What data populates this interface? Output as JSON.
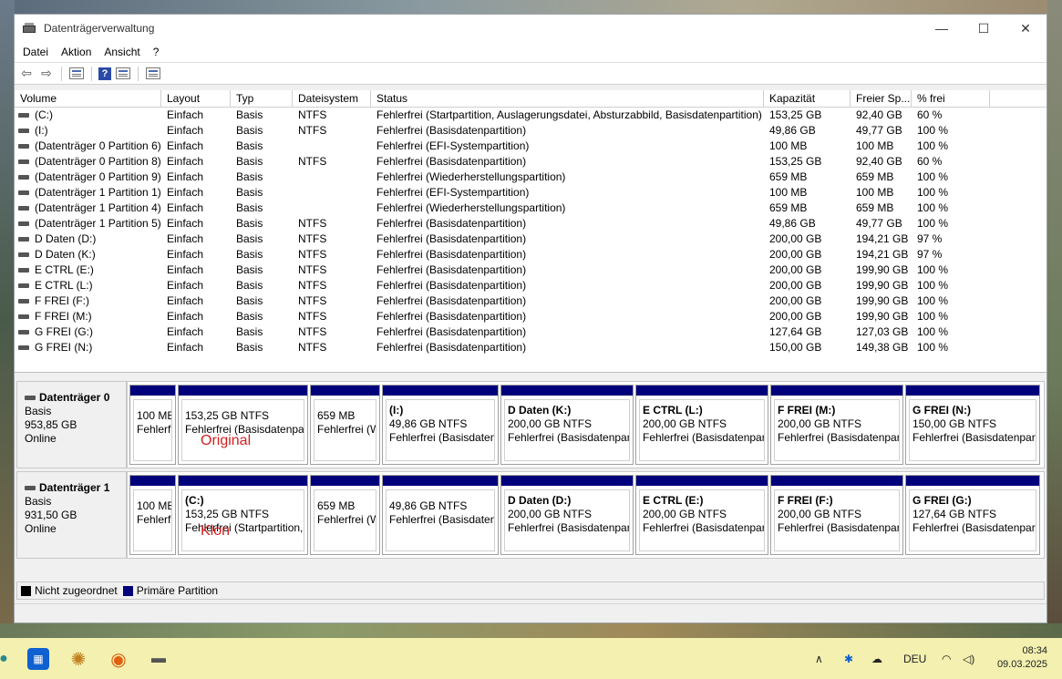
{
  "window": {
    "title": "Datenträgerverwaltung",
    "controls": [
      "—",
      "☐",
      "✕"
    ]
  },
  "menu": [
    "Datei",
    "Aktion",
    "Ansicht",
    "?"
  ],
  "volumes": {
    "headers": [
      "Volume",
      "Layout",
      "Typ",
      "Dateisystem",
      "Status",
      "Kapazität",
      "Freier Sp...",
      "% frei"
    ],
    "rows": [
      [
        "(C:)",
        "Einfach",
        "Basis",
        "NTFS",
        "Fehlerfrei (Startpartition, Auslagerungsdatei, Absturzabbild, Basisdatenpartition)",
        "153,25 GB",
        "92,40 GB",
        "60 %"
      ],
      [
        "(I:)",
        "Einfach",
        "Basis",
        "NTFS",
        "Fehlerfrei (Basisdatenpartition)",
        "49,86 GB",
        "49,77 GB",
        "100 %"
      ],
      [
        "(Datenträger 0 Partition 6)",
        "Einfach",
        "Basis",
        "",
        "Fehlerfrei (EFI-Systempartition)",
        "100 MB",
        "100 MB",
        "100 %"
      ],
      [
        "(Datenträger 0 Partition 8)",
        "Einfach",
        "Basis",
        "NTFS",
        "Fehlerfrei (Basisdatenpartition)",
        "153,25 GB",
        "92,40 GB",
        "60 %"
      ],
      [
        "(Datenträger 0 Partition 9)",
        "Einfach",
        "Basis",
        "",
        "Fehlerfrei (Wiederherstellungspartition)",
        "659 MB",
        "659 MB",
        "100 %"
      ],
      [
        "(Datenträger 1 Partition 1)",
        "Einfach",
        "Basis",
        "",
        "Fehlerfrei (EFI-Systempartition)",
        "100 MB",
        "100 MB",
        "100 %"
      ],
      [
        "(Datenträger 1 Partition 4)",
        "Einfach",
        "Basis",
        "",
        "Fehlerfrei (Wiederherstellungspartition)",
        "659 MB",
        "659 MB",
        "100 %"
      ],
      [
        "(Datenträger 1 Partition 5)",
        "Einfach",
        "Basis",
        "NTFS",
        "Fehlerfrei (Basisdatenpartition)",
        "49,86 GB",
        "49,77 GB",
        "100 %"
      ],
      [
        "D Daten  (D:)",
        "Einfach",
        "Basis",
        "NTFS",
        "Fehlerfrei (Basisdatenpartition)",
        "200,00 GB",
        "194,21 GB",
        "97 %"
      ],
      [
        "D Daten  (K:)",
        "Einfach",
        "Basis",
        "NTFS",
        "Fehlerfrei (Basisdatenpartition)",
        "200,00 GB",
        "194,21 GB",
        "97 %"
      ],
      [
        "E CTRL (E:)",
        "Einfach",
        "Basis",
        "NTFS",
        "Fehlerfrei (Basisdatenpartition)",
        "200,00 GB",
        "199,90 GB",
        "100 %"
      ],
      [
        "E CTRL (L:)",
        "Einfach",
        "Basis",
        "NTFS",
        "Fehlerfrei (Basisdatenpartition)",
        "200,00 GB",
        "199,90 GB",
        "100 %"
      ],
      [
        "F FREI (F:)",
        "Einfach",
        "Basis",
        "NTFS",
        "Fehlerfrei (Basisdatenpartition)",
        "200,00 GB",
        "199,90 GB",
        "100 %"
      ],
      [
        "F FREI (M:)",
        "Einfach",
        "Basis",
        "NTFS",
        "Fehlerfrei (Basisdatenpartition)",
        "200,00 GB",
        "199,90 GB",
        "100 %"
      ],
      [
        "G FREI (G:)",
        "Einfach",
        "Basis",
        "NTFS",
        "Fehlerfrei (Basisdatenpartition)",
        "127,64 GB",
        "127,03 GB",
        "100 %"
      ],
      [
        "G FREI (N:)",
        "Einfach",
        "Basis",
        "NTFS",
        "Fehlerfrei (Basisdatenpartition)",
        "150,00 GB",
        "149,38 GB",
        "100 %"
      ]
    ]
  },
  "disks": [
    {
      "name": "Datenträger 0",
      "type": "Basis",
      "size": "953,85 GB",
      "state": "Online",
      "note": "Original",
      "partitions": [
        {
          "name": "",
          "size": "100 MB",
          "status": "Fehlerfr"
        },
        {
          "name": "",
          "size": "153,25 GB NTFS",
          "status": "Fehlerfrei (Basisdatenpar"
        },
        {
          "name": "",
          "size": "659 MB",
          "status": "Fehlerfrei (W"
        },
        {
          "name": "(I:)",
          "size": "49,86 GB NTFS",
          "status": "Fehlerfrei (Basisdaten"
        },
        {
          "name": "D Daten  (K:)",
          "size": "200,00 GB NTFS",
          "status": "Fehlerfrei (Basisdatenpart"
        },
        {
          "name": "E CTRL  (L:)",
          "size": "200,00 GB NTFS",
          "status": "Fehlerfrei (Basisdatenpart"
        },
        {
          "name": "F FREI  (M:)",
          "size": "200,00 GB NTFS",
          "status": "Fehlerfrei (Basisdatenpart"
        },
        {
          "name": "G FREI  (N:)",
          "size": "150,00 GB NTFS",
          "status": "Fehlerfrei (Basisdatenpart"
        }
      ]
    },
    {
      "name": "Datenträger 1",
      "type": "Basis",
      "size": "931,50 GB",
      "state": "Online",
      "note": "Klon",
      "partitions": [
        {
          "name": "",
          "size": "100 MB",
          "status": "Fehlerfr"
        },
        {
          "name": "(C:)",
          "size": "153,25 GB NTFS",
          "status": "Fehlerfrei (Startpartition,"
        },
        {
          "name": "",
          "size": "659 MB",
          "status": "Fehlerfrei (W"
        },
        {
          "name": "",
          "size": "49,86 GB NTFS",
          "status": "Fehlerfrei (Basisdaten"
        },
        {
          "name": "D Daten  (D:)",
          "size": "200,00 GB NTFS",
          "status": "Fehlerfrei (Basisdatenpart"
        },
        {
          "name": "E CTRL  (E:)",
          "size": "200,00 GB NTFS",
          "status": "Fehlerfrei (Basisdatenpart"
        },
        {
          "name": "F FREI  (F:)",
          "size": "200,00 GB NTFS",
          "status": "Fehlerfrei (Basisdatenpart"
        },
        {
          "name": "G FREI  (G:)",
          "size": "127,64 GB NTFS",
          "status": "Fehlerfrei (Basisdatenpart"
        }
      ]
    }
  ],
  "legend": [
    "Nicht zugeordnet",
    "Primäre Partition"
  ],
  "colors": {
    "primary_partition": "#00007b",
    "unallocated": "#000000",
    "annotation": "#d02020",
    "taskbar": "#f3f0b0"
  },
  "taskbar": {
    "language": "DEU",
    "time": "08:34",
    "date": "09.03.2025"
  }
}
